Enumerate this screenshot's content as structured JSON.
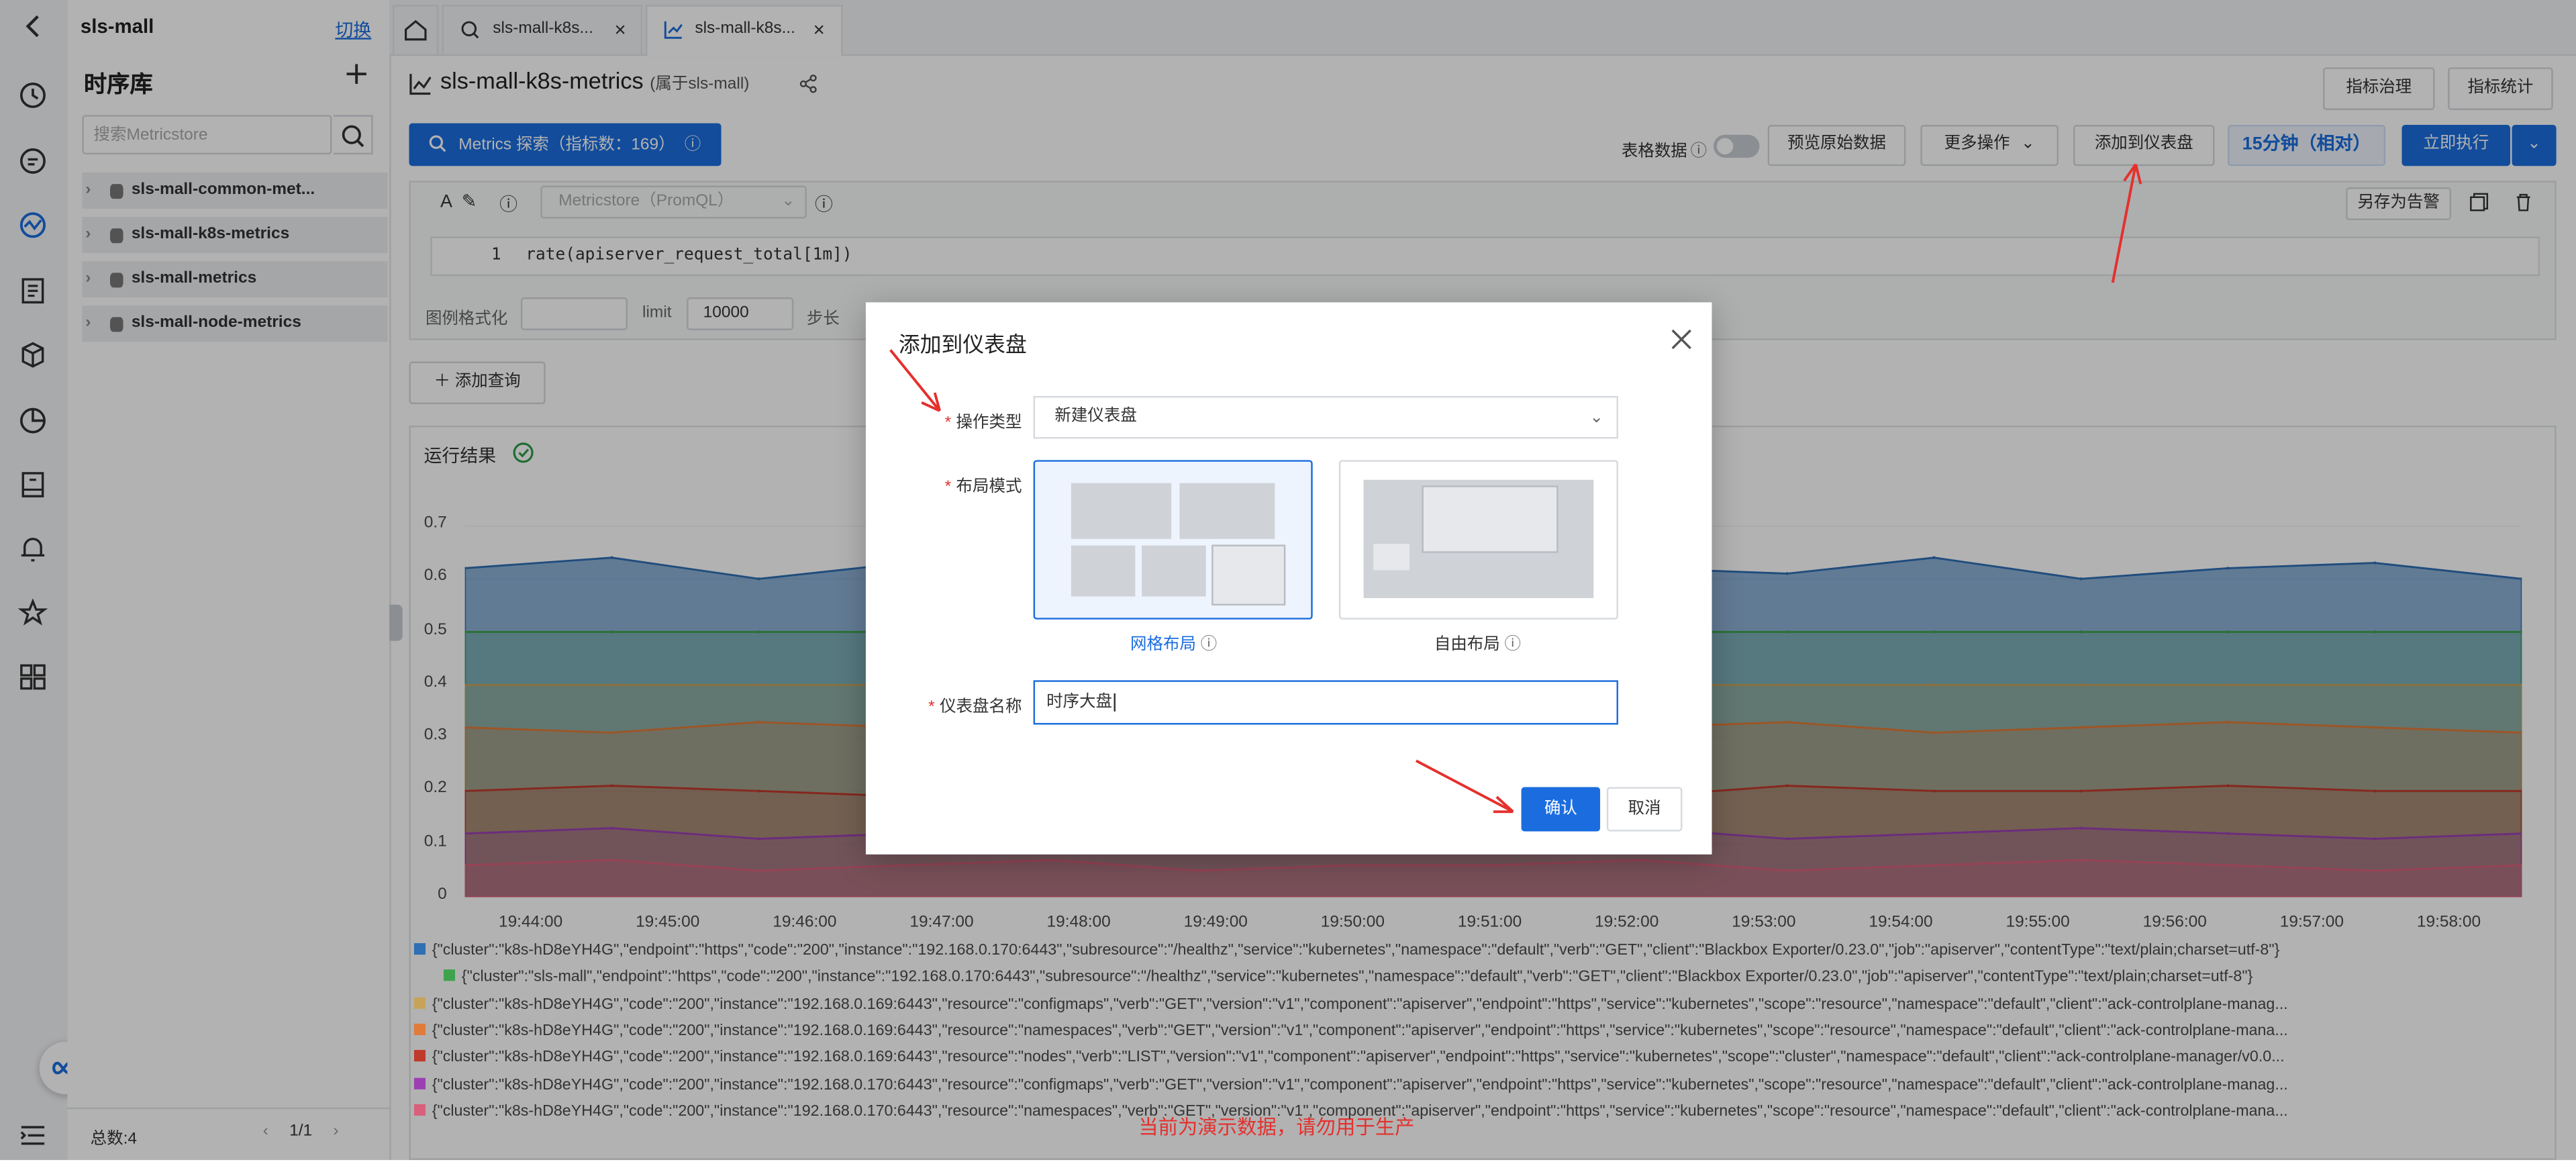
{
  "project": {
    "name": "sls-mall",
    "switch_label": "切换"
  },
  "rail_icons": [
    "back-icon",
    "clock-icon",
    "query-icon",
    "metrics-icon",
    "list-icon",
    "box-icon",
    "pie-icon",
    "report-icon",
    "bell-icon",
    "star-icon",
    "grid-icon",
    "menu-icon"
  ],
  "sidebar": {
    "title": "时序库",
    "search_placeholder": "搜索Metricstore",
    "items": [
      {
        "label": "sls-mall-common-met..."
      },
      {
        "label": "sls-mall-k8s-metrics"
      },
      {
        "label": "sls-mall-metrics"
      },
      {
        "label": "sls-mall-node-metrics"
      }
    ],
    "total": "总数:4",
    "page": "1/1"
  },
  "tabs": [
    {
      "label": "sls-mall-k8s...",
      "close": "×"
    },
    {
      "label": "sls-mall-k8s...",
      "close": "×"
    }
  ],
  "header": {
    "title": "sls-mall-k8s-metrics",
    "subtitle": "(属于sls-mall)",
    "btn_metric_govern": "指标治理",
    "btn_metric_stats": "指标统计"
  },
  "toolbar": {
    "metrics_explore": "Metrics 探索（指标数：169）",
    "table_data": "表格数据",
    "preview_raw": "预览原始数据",
    "more_ops": "更多操作",
    "add_dashboard": "添加到仪表盘",
    "time_range": "15分钟（相对）",
    "run_now": "立即执行"
  },
  "query": {
    "store_placeholder": "Metricstore（PromQL）",
    "save_alert": "另存为告警",
    "line_no": "1",
    "expression": "rate(apiserver_request_total[1m])",
    "legend_format_label": "图例格式化",
    "limit_label": "limit",
    "limit_value": "10000",
    "step_label": "步长",
    "add_query": "添加查询"
  },
  "result": {
    "title": "运行结果"
  },
  "chart_data": {
    "type": "area",
    "title": "",
    "xlabel": "",
    "ylabel": "",
    "ylim": [
      0,
      0.7
    ],
    "yticks": [
      "0.7",
      "0.6",
      "0.5",
      "0.4",
      "0.3",
      "0.2",
      "0.1",
      "0"
    ],
    "x": [
      "19:44:00",
      "19:45:00",
      "19:46:00",
      "19:47:00",
      "19:48:00",
      "19:49:00",
      "19:50:00",
      "19:51:00",
      "19:52:00",
      "19:53:00",
      "19:54:00",
      "19:55:00",
      "19:56:00",
      "19:57:00",
      "19:58:00"
    ],
    "series": [
      {
        "name": "{\"cluster\":\"k8s-hD8eYH4G\",\"endpoint\":\"https\",\"code\":\"200\",\"instance\":\"192.168.0.170:6443\",\"subresource\":\"/healthz\",\"service\":\"kubernetes\",\"namespace\":\"default\",\"verb\":\"GET\",\"client\":\"Blackbox Exporter/0.23.0\",\"job\":\"apiserver\",\"contentType\":\"text/plain;charset=utf-8\"}",
        "color": "#2f6fb3",
        "values": [
          0.62,
          0.64,
          0.6,
          0.63,
          0.61,
          0.62,
          0.6,
          0.63,
          0.62,
          0.61,
          0.64,
          0.6,
          0.62,
          0.63,
          0.6
        ]
      },
      {
        "name": "{\"cluster\":\"sls-mall\",\"endpoint\":\"https\",\"code\":\"200\",\"instance\":\"192.168.0.170:6443\",\"subresource\":\"/healthz\",\"service\":\"kubernetes\",\"namespace\":\"default\",\"verb\":\"GET\",\"client\":\"Blackbox Exporter/0.23.0\",\"job\":\"apiserver\",\"contentType\":\"text/plain;charset=utf-8\"}",
        "color": "#3fa34d",
        "values": [
          0.5,
          0.5,
          0.5,
          0.5,
          0.5,
          0.5,
          0.5,
          0.5,
          0.5,
          0.5,
          0.5,
          0.5,
          0.5,
          0.5,
          0.5
        ]
      },
      {
        "name": "{\"cluster\":\"k8s-hD8eYH4G\",\"code\":\"200\",\"instance\":\"192.168.0.169:6443\",\"resource\":\"configmaps\",\"verb\":\"GET\",\"version\":\"v1\",\"component\":\"apiserver\",\"endpoint\":\"https\",\"service\":\"kubernetes\",\"scope\":\"resource\",\"namespace\":\"default\",\"client\":\"ack-controlplane-manag...",
        "color": "#c7a35a",
        "values": [
          0.4,
          0.4,
          0.4,
          0.4,
          0.4,
          0.4,
          0.4,
          0.4,
          0.4,
          0.4,
          0.4,
          0.4,
          0.4,
          0.4,
          0.4
        ]
      },
      {
        "name": "{\"cluster\":\"k8s-hD8eYH4G\",\"code\":\"200\",\"instance\":\"192.168.0.169:6443\",\"resource\":\"namespaces\",\"verb\":\"GET\",\"version\":\"v1\",\"component\":\"apiserver\",\"endpoint\":\"https\",\"service\":\"kubernetes\",\"scope\":\"resource\",\"namespace\":\"default\",\"client\":\"ack-controlplane-mana...",
        "color": "#e07b39",
        "values": [
          0.32,
          0.31,
          0.33,
          0.32,
          0.31,
          0.32,
          0.33,
          0.31,
          0.32,
          0.33,
          0.31,
          0.32,
          0.33,
          0.32,
          0.31
        ]
      },
      {
        "name": "{\"cluster\":\"k8s-hD8eYH4G\",\"code\":\"200\",\"instance\":\"192.168.0.169:6443\",\"resource\":\"nodes\",\"verb\":\"LIST\",\"version\":\"v1\",\"component\":\"apiserver\",\"endpoint\":\"https\",\"service\":\"kubernetes\",\"scope\":\"cluster\",\"namespace\":\"default\",\"client\":\"ack-controlplane-manager/v0.0...",
        "color": "#c0392b",
        "values": [
          0.2,
          0.21,
          0.2,
          0.19,
          0.2,
          0.21,
          0.2,
          0.2,
          0.19,
          0.21,
          0.2,
          0.2,
          0.21,
          0.2,
          0.2
        ]
      },
      {
        "name": "{\"cluster\":\"k8s-hD8eYH4G\",\"code\":\"200\",\"instance\":\"192.168.0.170:6443\",\"resource\":\"configmaps\",\"verb\":\"GET\",\"version\":\"v1\",\"component\":\"apiserver\",\"endpoint\":\"https\",\"service\":\"kubernetes\",\"scope\":\"resource\",\"namespace\":\"default\",\"client\":\"ack-controlplane-manag...",
        "color": "#9b3fb3",
        "values": [
          0.12,
          0.13,
          0.11,
          0.12,
          0.13,
          0.11,
          0.12,
          0.12,
          0.13,
          0.11,
          0.12,
          0.13,
          0.12,
          0.11,
          0.12
        ]
      },
      {
        "name": "{\"cluster\":\"k8s-hD8eYH4G\",\"code\":\"200\",\"instance\":\"192.168.0.170:6443\",\"resource\":\"namespaces\",\"verb\":\"GET\",\"version\":\"v1\",\"component\":\"apiserver\",\"endpoint\":\"https\",\"service\":\"kubernetes\",\"scope\":\"resource\",\"namespace\":\"default\",\"client\":\"ack-controlplane-mana...",
        "color": "#d9607a",
        "values": [
          0.06,
          0.07,
          0.05,
          0.06,
          0.07,
          0.05,
          0.06,
          0.06,
          0.07,
          0.05,
          0.06,
          0.07,
          0.06,
          0.05,
          0.06
        ]
      }
    ]
  },
  "modal": {
    "title": "添加到仪表盘",
    "op_type_label": "操作类型",
    "op_type_value": "新建仪表盘",
    "layout_label": "布局模式",
    "layout_grid": "网格布局",
    "layout_free": "自由布局",
    "name_label": "仪表盘名称",
    "name_value": "时序大盘",
    "confirm": "确认",
    "cancel": "取消"
  },
  "watermark": "当前为演示数据，请勿用于生产",
  "colors": {
    "primary": "#1b6ddf",
    "annotation": "#e5302d"
  }
}
